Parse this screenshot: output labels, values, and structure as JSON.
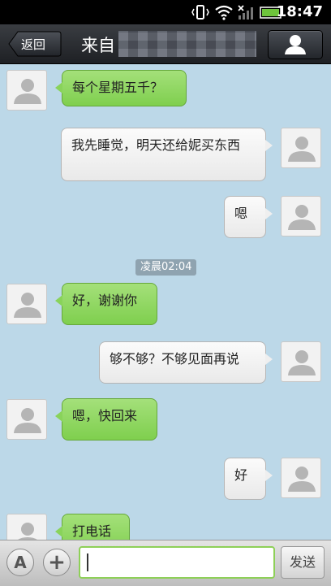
{
  "status_bar": {
    "time": "18:47"
  },
  "header": {
    "back_label": "返回",
    "title_prefix": "来自"
  },
  "messages": [
    {
      "direction": "in",
      "text": "每个星期五千？"
    },
    {
      "direction": "out",
      "text": "我先睡觉，明天还给妮买东西"
    },
    {
      "direction": "out",
      "text": "嗯"
    },
    {
      "direction": "in",
      "text": "好，谢谢你"
    },
    {
      "direction": "out",
      "text": "够不够？不够见面再说"
    },
    {
      "direction": "in",
      "text": "嗯，快回来"
    },
    {
      "direction": "out",
      "text": "好"
    },
    {
      "direction": "in",
      "text": "打电话"
    }
  ],
  "timestamp": "凌晨02:04",
  "input_bar": {
    "font_button_label": "A",
    "add_button_label": "+",
    "message_value": "",
    "send_label": "发送"
  },
  "colors": {
    "incoming_bubble": "#8bd65c",
    "outgoing_bubble": "#f2f2f2",
    "chat_background": "#bcd8e8"
  }
}
